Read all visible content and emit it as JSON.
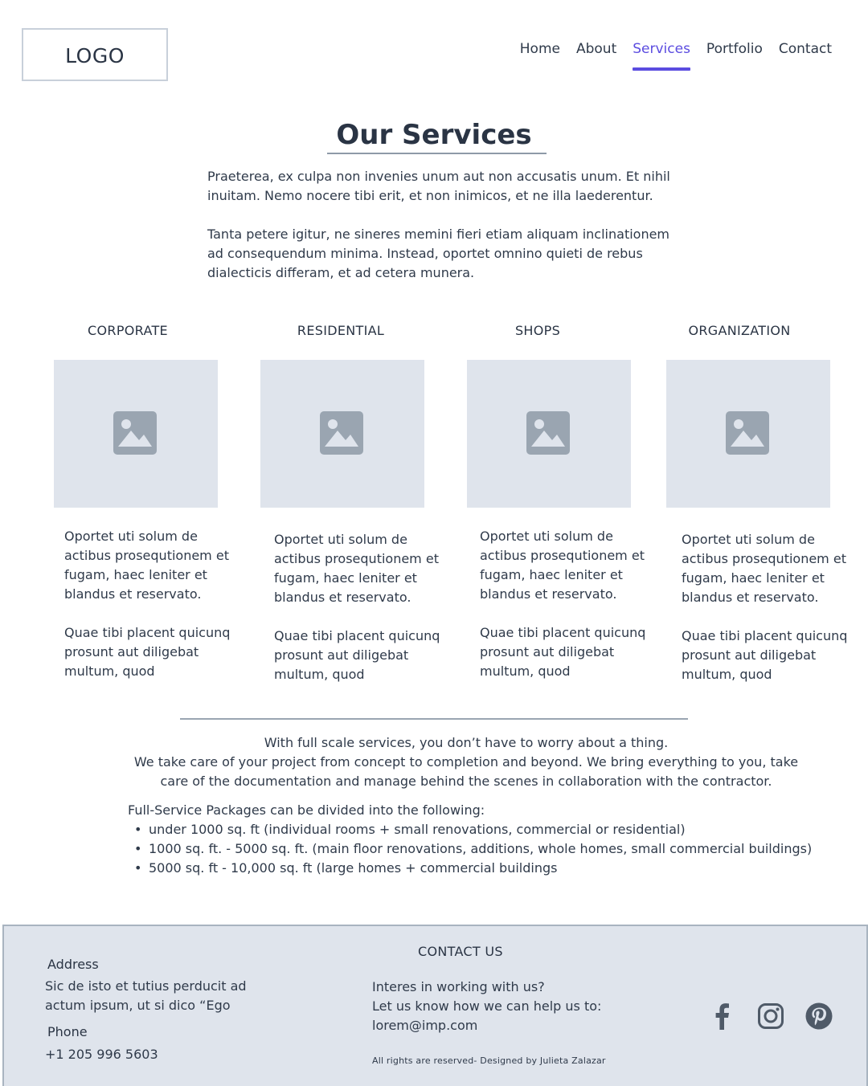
{
  "header": {
    "logo": "LOGO",
    "nav": [
      {
        "label": "Home",
        "active": false
      },
      {
        "label": "About",
        "active": false
      },
      {
        "label": "Services",
        "active": true
      },
      {
        "label": "Portfolio",
        "active": false
      },
      {
        "label": "Contact",
        "active": false
      }
    ],
    "accent_color": "#5b4ce0"
  },
  "main": {
    "title": "Our Services",
    "intro": [
      "Praeterea, ex culpa non invenies unum aut non accusatis unum. Et nihil inuitam. Nemo nocere tibi erit, et non inimicos, et ne illa laederentur.",
      "Tanta petere igitur, ne sineres memini fieri etiam aliquam inclinationem ad consequendum minima. Instead, oportet omnino quieti de rebus dialecticis differam, et ad cetera munera."
    ],
    "categories": [
      {
        "title": "CORPORATE",
        "image_icon": "image-placeholder-icon",
        "text": [
          "Oportet uti solum de actibus prosequtionem et fugam, haec leniter et blandus et reservato.",
          "Quae tibi placent quicunq prosunt aut diligebat multum, quod"
        ]
      },
      {
        "title": "RESIDENTIAL",
        "image_icon": "image-placeholder-icon",
        "text": [
          "Oportet uti solum de actibus prosequtionem et fugam, haec leniter et blandus et reservato.",
          "Quae tibi placent quicunq prosunt aut diligebat multum, quod"
        ]
      },
      {
        "title": "SHOPS",
        "image_icon": "image-placeholder-icon",
        "text": [
          "Oportet uti solum de actibus prosequtionem et fugam, haec leniter et blandus et reservato.",
          "Quae tibi placent quicunq prosunt aut diligebat multum, quod"
        ]
      },
      {
        "title": "ORGANIZATION",
        "image_icon": "image-placeholder-icon",
        "text": [
          "Oportet uti solum de actibus prosequtionem et fugam, haec leniter et blandus et reservato.",
          "Quae tibi placent quicunq prosunt aut diligebat multum, quod"
        ]
      }
    ],
    "summary": [
      "With full scale services, you don’t have to worry about a thing.",
      "We take care of your project from concept to completion and beyond. We bring everything to you, take care of the documentation and manage behind the scenes in collaboration with the contractor."
    ],
    "packages": {
      "intro": "Full-Service Packages can be divided into the following:",
      "items": [
        "under 1000 sq. ft (individual rooms + small renovations, commercial or residential)",
        "1000 sq. ft. - 5000 sq. ft. (main floor renovations, additions, whole homes, small commercial buildings)",
        "5000 sq. ft - 10,000 sq. ft (large homes + commercial buildings"
      ]
    }
  },
  "footer": {
    "address_label": "Address",
    "address_lines": [
      "Sic de isto et tutius perducit ad",
      "actum ipsum, ut si dico “Ego"
    ],
    "phone_label": "Phone",
    "phone": "+1 205 996 5603",
    "contact_heading": "CONTACT US",
    "contact_lines": [
      "Interes in working with us?",
      "Let us know how we can help us to:",
      "lorem@imp.com"
    ],
    "copyright": "All rights are reserved- Designed by Julieta Zalazar",
    "social": [
      "facebook-icon",
      "instagram-icon",
      "pinterest-icon"
    ],
    "background_color": "#dfe4ec"
  }
}
